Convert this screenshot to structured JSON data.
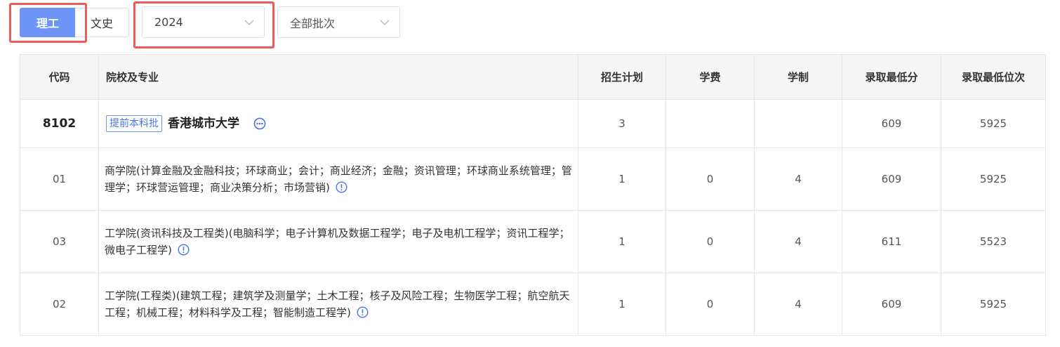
{
  "filters": {
    "subjects": [
      "理工",
      "文史"
    ],
    "active_subject": "理工",
    "year": "2024",
    "batch": "全部批次"
  },
  "table": {
    "headers": {
      "code": "代码",
      "school": "院校及专业",
      "plan": "招生计划",
      "tuition": "学费",
      "duration": "学制",
      "min_score": "录取最低分",
      "min_rank": "录取最低位次"
    },
    "university": {
      "code": "8102",
      "batch_tag": "提前本科批",
      "name": "香港城市大学",
      "plan": "3",
      "tuition": "",
      "duration": "",
      "min_score": "609",
      "min_rank": "5925"
    },
    "majors": [
      {
        "code": "01",
        "name": "商学院(计算金融及金融科技；环球商业；会计；商业经济；金融；资讯管理；环球商业系统管理；管理学；环球营运管理；商业决策分析；市场营销)",
        "plan": "1",
        "tuition": "0",
        "duration": "4",
        "min_score": "609",
        "min_rank": "5925"
      },
      {
        "code": "03",
        "name": "工学院(资讯科技及工程类)(电脑科学；电子计算机及数据工程学；电子及电机工程学；资讯工程学；微电子工程学)",
        "plan": "1",
        "tuition": "0",
        "duration": "4",
        "min_score": "611",
        "min_rank": "5523"
      },
      {
        "code": "02",
        "name": "工学院(工程类)(建筑工程；建筑学及测量学；土木工程；核子及风险工程；生物医学工程；航空航天工程；机械工程；材料科学及工程；智能制造工程学)",
        "plan": "1",
        "tuition": "0",
        "duration": "4",
        "min_score": "609",
        "min_rank": "5925"
      }
    ]
  },
  "colors": {
    "accent": "#6d94f7",
    "highlight_border": "#ec5a5a",
    "header_bg": "#f5f5f5",
    "border": "#e6e6e6"
  },
  "icons": {
    "select_arrow": "chevron-down-icon",
    "university_more": "more-icon",
    "major_info": "info-icon"
  }
}
